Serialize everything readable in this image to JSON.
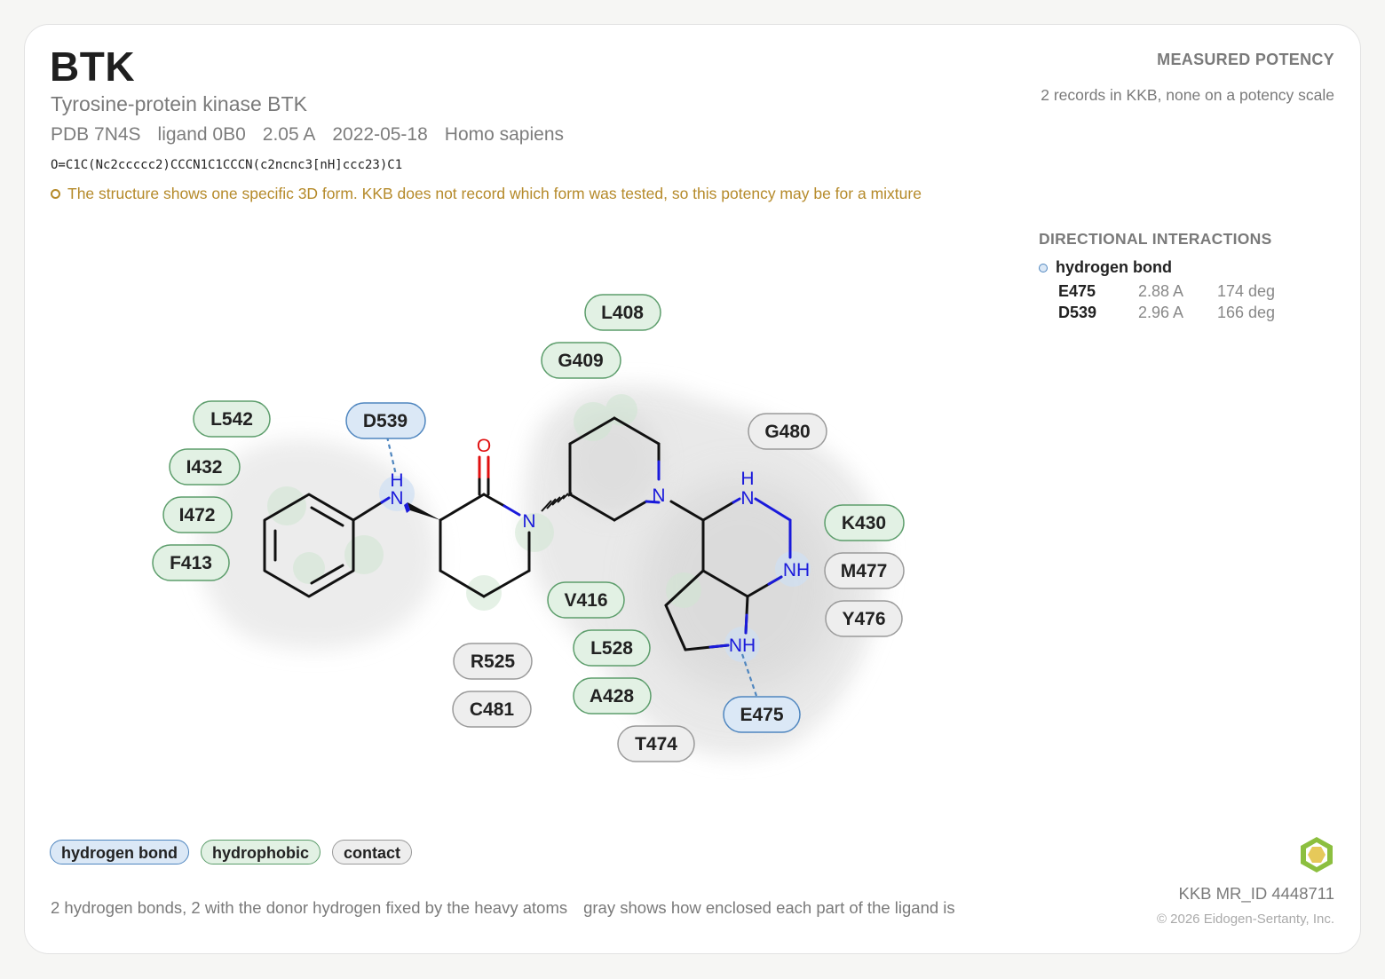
{
  "header": {
    "title": "BTK",
    "subtitle": "Tyrosine-protein kinase BTK",
    "meta": {
      "pdb": "PDB 7N4S",
      "ligand": "ligand 0B0",
      "resolution": "2.05 A",
      "date": "2022-05-18",
      "organism": "Homo sapiens"
    },
    "smiles": "O=C1C(Nc2ccccc2)CCCN1C1CCCN(c2ncnc3[nH]ccc23)C1",
    "warning": "The structure shows one specific 3D form. KKB does not record which form was tested, so this potency may be for a mixture"
  },
  "potency": {
    "heading": "MEASURED POTENCY",
    "note": "2 records in KKB, none on a potency scale"
  },
  "directional": {
    "heading": "DIRECTIONAL INTERACTIONS",
    "type_label": "hydrogen bond",
    "rows": [
      {
        "residue": "E475",
        "distance": "2.88 A",
        "angle": "174 deg"
      },
      {
        "residue": "D539",
        "distance": "2.96 A",
        "angle": "166 deg"
      }
    ]
  },
  "diagram": {
    "atoms": {
      "O": "O",
      "N_amide": "N",
      "N_pip": "N",
      "N_H_top": "N",
      "H_top": "H",
      "NH_right": "NH",
      "NH_bottom": "NH",
      "H_aniline": "H",
      "N_aniline": "N"
    },
    "residues": {
      "L408": "L408",
      "G409": "G409",
      "L542": "L542",
      "D539": "D539",
      "I432": "I432",
      "I472": "I472",
      "F413": "F413",
      "G480": "G480",
      "K430": "K430",
      "M477": "M477",
      "Y476": "Y476",
      "V416": "V416",
      "L528": "L528",
      "A428": "A428",
      "R525": "R525",
      "C481": "C481",
      "E475": "E475",
      "T474": "T474"
    }
  },
  "legend": {
    "hbond": "hydrogen bond",
    "hydrophobic": "hydrophobic",
    "contact": "contact"
  },
  "footer": {
    "hbond_summary": "2 hydrogen bonds, 2 with the donor hydrogen fixed by the heavy atoms",
    "shading_note": "gray shows how enclosed each part of the ligand is",
    "mrid": "KKB MR_ID 4448711",
    "copyright": "© 2026 Eidogen-Sertanty, Inc."
  },
  "colors": {
    "hbond_fill": "#dbe8f6",
    "hbond_stroke": "#4f86bf",
    "hydrophobic_fill": "#e2f1e4",
    "hydrophobic_stroke": "#5c9d6b",
    "contact_fill": "#eeeeee",
    "contact_stroke": "#9a9a9a",
    "nitrogen": "#1a1adb",
    "oxygen": "#e01010",
    "warning": "#b58a2a"
  }
}
